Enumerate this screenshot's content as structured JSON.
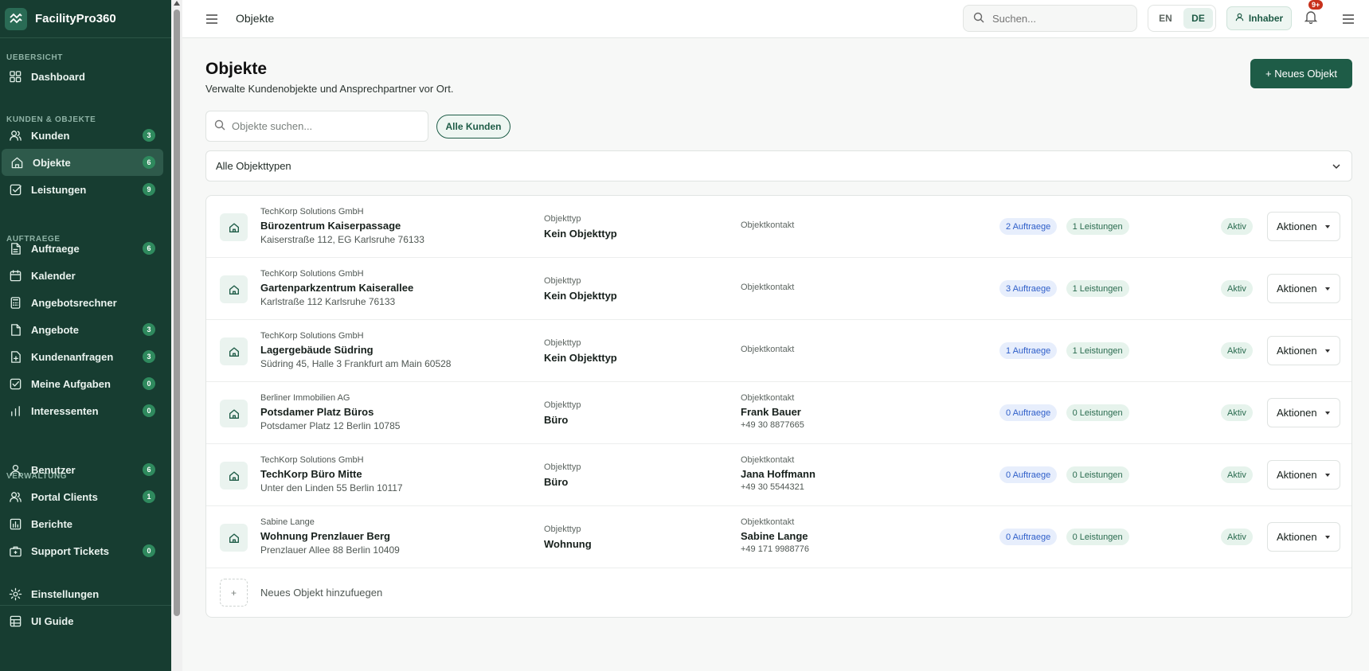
{
  "app": {
    "name": "FacilityPro360"
  },
  "sidebar": {
    "sections": [
      {
        "label": "UEBERSICHT"
      },
      {
        "label": "KUNDEN & OBJEKTE"
      },
      {
        "label": "AUFTRAEGE"
      },
      {
        "label": "VERWALTUNG"
      }
    ],
    "items": [
      {
        "label": "Dashboard",
        "icon": "grid-icon"
      },
      {
        "label": "Kunden",
        "badge": "3",
        "icon": "users-icon"
      },
      {
        "label": "Objekte",
        "badge": "6",
        "icon": "home-icon",
        "active": true
      },
      {
        "label": "Leistungen",
        "badge": "9",
        "icon": "checkbox-icon"
      },
      {
        "label": "Auftraege",
        "badge": "6",
        "icon": "document-icon"
      },
      {
        "label": "Kalender",
        "icon": "calendar-icon"
      },
      {
        "label": "Angebotsrechner",
        "icon": "calculator-icon"
      },
      {
        "label": "Angebote",
        "badge": "3",
        "icon": "file-icon"
      },
      {
        "label": "Kundenanfragen",
        "badge": "3",
        "icon": "file-plus-icon"
      },
      {
        "label": "Meine Aufgaben",
        "badge": "0",
        "icon": "task-icon"
      },
      {
        "label": "Interessenten",
        "badge": "0",
        "icon": "bar-chart-icon"
      },
      {
        "label": "Benutzer",
        "badge": "6",
        "icon": "user-icon"
      },
      {
        "label": "Portal Clients",
        "badge": "1",
        "icon": "users-icon"
      },
      {
        "label": "Berichte",
        "icon": "report-icon"
      },
      {
        "label": "Support Tickets",
        "badge": "0",
        "icon": "briefcase-icon"
      },
      {
        "label": "Einstellungen",
        "icon": "gear-icon"
      },
      {
        "label": "UI Guide",
        "icon": "table-icon"
      }
    ]
  },
  "topbar": {
    "title": "Objekte",
    "search_placeholder": "Suchen...",
    "lang_en": "EN",
    "lang_de": "DE",
    "role": "Inhaber",
    "notif_badge": "9+"
  },
  "main": {
    "title": "Objekte",
    "subtitle": "Verwalte Kundenobjekte und Ansprechpartner vor Ort.",
    "new_button": "+ Neues Objekt",
    "search_placeholder": "Objekte suchen...",
    "filter_chip": "Alle Kunden",
    "type_select": "Alle Objekttypen",
    "type_label": "Objekttyp",
    "contact_label": "Objektkontakt",
    "status_label": "Aktiv",
    "actions_label": "Aktionen",
    "add_label": "Neues Objekt hinzufuegen",
    "add_plus": "+"
  },
  "objects": [
    {
      "customer": "TechKorp Solutions GmbH",
      "name": "Bürozentrum Kaiserpassage",
      "address": "Kaiserstraße 112, EG Karlsruhe 76133",
      "type": "Kein Objekttyp",
      "contact_name": "",
      "contact_phone": "",
      "orders": "2 Auftraege",
      "services": "1 Leistungen"
    },
    {
      "customer": "TechKorp Solutions GmbH",
      "name": "Gartenparkzentrum Kaiserallee",
      "address": "Karlstraße 112 Karlsruhe 76133",
      "type": "Kein Objekttyp",
      "contact_name": "",
      "contact_phone": "",
      "orders": "3 Auftraege",
      "services": "1 Leistungen"
    },
    {
      "customer": "TechKorp Solutions GmbH",
      "name": "Lagergebäude Südring",
      "address": "Südring 45, Halle 3 Frankfurt am Main 60528",
      "type": "Kein Objekttyp",
      "contact_name": "",
      "contact_phone": "",
      "orders": "1 Auftraege",
      "services": "1 Leistungen"
    },
    {
      "customer": "Berliner Immobilien AG",
      "name": "Potsdamer Platz Büros",
      "address": "Potsdamer Platz 12 Berlin 10785",
      "type": "Büro",
      "contact_name": "Frank Bauer",
      "contact_phone": "+49 30 8877665",
      "orders": "0 Auftraege",
      "services": "0 Leistungen"
    },
    {
      "customer": "TechKorp Solutions GmbH",
      "name": "TechKorp Büro Mitte",
      "address": "Unter den Linden 55 Berlin 10117",
      "type": "Büro",
      "contact_name": "Jana Hoffmann",
      "contact_phone": "+49 30 5544321",
      "orders": "0 Auftraege",
      "services": "0 Leistungen"
    },
    {
      "customer": "Sabine Lange",
      "name": "Wohnung Prenzlauer Berg",
      "address": "Prenzlauer Allee 88 Berlin 10409",
      "type": "Wohnung",
      "contact_name": "Sabine Lange",
      "contact_phone": "+49 171 9988776",
      "orders": "0 Auftraege",
      "services": "0 Leistungen"
    }
  ],
  "colors": {
    "sidebar_bg": "#173d31",
    "accent": "#1e5c47",
    "badge": "#2f8a5e"
  }
}
